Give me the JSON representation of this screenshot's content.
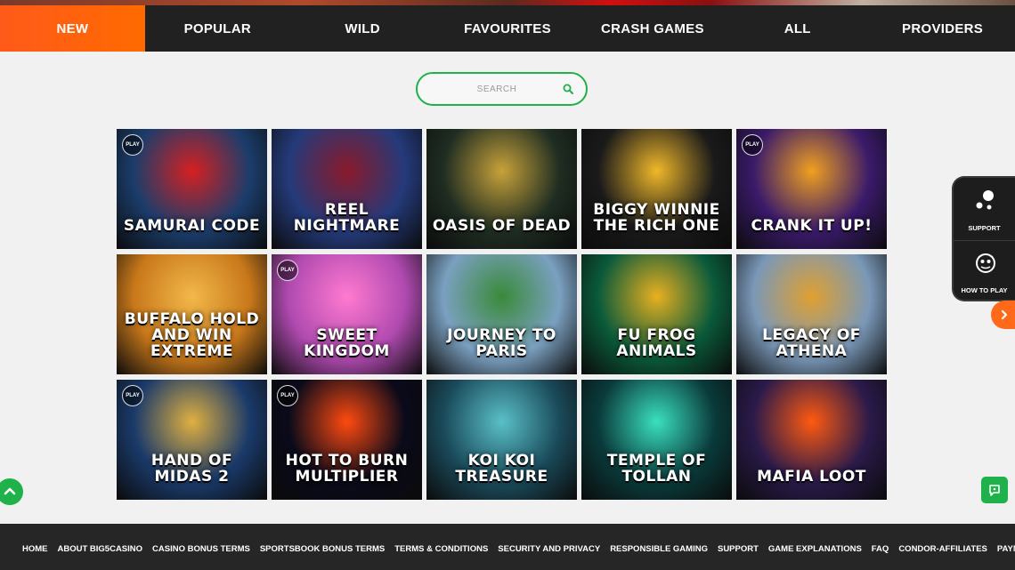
{
  "nav": {
    "tabs": [
      {
        "label": "NEW",
        "active": true
      },
      {
        "label": "POPULAR",
        "active": false
      },
      {
        "label": "WILD",
        "active": false
      },
      {
        "label": "FAVOURITES",
        "active": false
      },
      {
        "label": "CRASH GAMES",
        "active": false
      },
      {
        "label": "ALL",
        "active": false
      },
      {
        "label": "PROVIDERS",
        "active": false
      }
    ]
  },
  "search": {
    "placeholder": "SEARCH",
    "value": ""
  },
  "games": [
    {
      "title": "SAMURAI CODE",
      "play_badge": true,
      "bg": "#1b3d6b",
      "accent": "#d62020"
    },
    {
      "title": "REEL NIGHTMARE",
      "play_badge": false,
      "bg": "#243a7a",
      "accent": "#8a1a2a"
    },
    {
      "title": "OASIS OF DEAD",
      "play_badge": false,
      "bg": "#1f2d22",
      "accent": "#c8a23a"
    },
    {
      "title": "BIGGY WINNIE THE RICH ONE",
      "play_badge": false,
      "bg": "#1a1a1a",
      "accent": "#f0b82a"
    },
    {
      "title": "CRANK IT UP!",
      "play_badge": true,
      "bg": "#3a1a6a",
      "accent": "#f0a020"
    },
    {
      "title": "BUFFALO HOLD AND WIN EXTREME",
      "play_badge": false,
      "bg": "#c8781a",
      "accent": "#f2b84a"
    },
    {
      "title": "SWEET KINGDOM",
      "play_badge": true,
      "bg": "#b04ab0",
      "accent": "#ff7ad0"
    },
    {
      "title": "JOURNEY TO PARIS",
      "play_badge": false,
      "bg": "#7aa0c0",
      "accent": "#3a8a3a"
    },
    {
      "title": "FU FROG ANIMALS",
      "play_badge": false,
      "bg": "#0a5a3a",
      "accent": "#e8b020"
    },
    {
      "title": "LEGACY OF ATHENA",
      "play_badge": false,
      "bg": "#7a98b8",
      "accent": "#e0a030"
    },
    {
      "title": "HAND OF MIDAS 2",
      "play_badge": true,
      "bg": "#1a3a6a",
      "accent": "#e0b040"
    },
    {
      "title": "HOT TO BURN MULTIPLIER",
      "play_badge": true,
      "bg": "#0a0a1a",
      "accent": "#ff4a10"
    },
    {
      "title": "KOI KOI TREASURE",
      "play_badge": false,
      "bg": "#1a4a5a",
      "accent": "#5ac0c8"
    },
    {
      "title": "TEMPLE OF TOLLAN",
      "play_badge": false,
      "bg": "#0a3a3a",
      "accent": "#3ae0c0"
    },
    {
      "title": "MAFIA LOOT",
      "play_badge": false,
      "bg": "#2a1a4a",
      "accent": "#ff5a10"
    }
  ],
  "play_badge_label": "PLAY",
  "side_panel": {
    "support_label": "SUPPORT",
    "how_to_play_label": "HOW TO PLAY"
  },
  "footer": {
    "links": [
      "HOME",
      "ABOUT BIG5CASINO",
      "CASINO BONUS TERMS",
      "SPORTSBOOK BONUS TERMS",
      "TERMS & CONDITIONS",
      "SECURITY AND PRIVACY",
      "RESPONSIBLE GAMING",
      "SUPPORT",
      "GAME EXPLANATIONS",
      "FAQ",
      "CONDOR-AFFILIATES",
      "PAYMENTS"
    ]
  },
  "colors": {
    "accent_orange": "#ff6a00",
    "accent_green": "#1fb14a",
    "nav_bg": "#212121",
    "footer_bg": "#262626"
  }
}
